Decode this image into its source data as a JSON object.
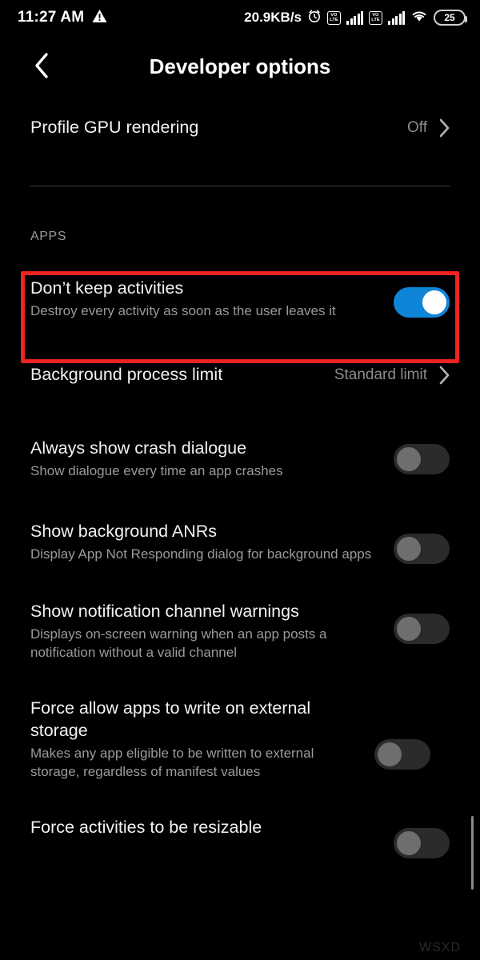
{
  "status_bar": {
    "time": "11:27 AM",
    "warning_icon": "warning-triangle-icon",
    "network_speed": "20.9KB/s",
    "alarm_icon": "alarm-clock-icon",
    "sim1_label": "VO",
    "sim1_label2": "LTE",
    "sim2_label": "VO",
    "sim2_label2": "LTE",
    "wifi_icon": "wifi-icon",
    "battery_level": "25"
  },
  "app_bar": {
    "back_icon": "chevron-left-icon",
    "title": "Developer options"
  },
  "section_header": "APPS",
  "rows": [
    {
      "title": "Profile GPU rendering",
      "subtitle": "",
      "value": "Off",
      "control": "chevron"
    },
    {
      "title": "Don’t keep activities",
      "subtitle": "Destroy every activity as soon as the user leaves it",
      "value": "",
      "control": "switch-on"
    },
    {
      "title": "Background process limit",
      "subtitle": "",
      "value": "Standard limit",
      "control": "chevron"
    },
    {
      "title": "Always show crash dialogue",
      "subtitle": "Show dialogue every time an app crashes",
      "value": "",
      "control": "switch-off"
    },
    {
      "title": "Show background ANRs",
      "subtitle": "Display App Not Responding dialog for background apps",
      "value": "",
      "control": "switch-off"
    },
    {
      "title": "Show notification channel warnings",
      "subtitle": "Displays on-screen warning when an app posts a notification without a valid channel",
      "value": "",
      "control": "switch-off"
    },
    {
      "title": "Force allow apps to write on external storage",
      "subtitle": "Makes any app eligible to be written to external storage, regardless of manifest values",
      "value": "",
      "control": "switch-off"
    },
    {
      "title": "Force activities to be resizable",
      "subtitle": "",
      "value": "",
      "control": "switch-off"
    }
  ],
  "highlight": {
    "color": "#ee2222",
    "target_row_title": "Don’t keep activities"
  },
  "watermark": "WSXD",
  "colors": {
    "background": "#000000",
    "title_text": "#f2f2f2",
    "subtitle_text": "#9a9a9a",
    "accent_on": "#0f85d8",
    "highlight_red": "#ee2222"
  }
}
